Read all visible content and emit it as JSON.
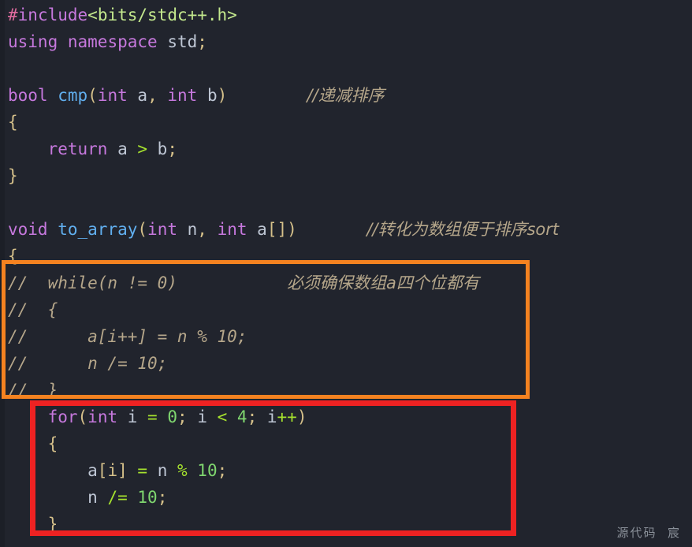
{
  "editor": {
    "background_color": "#21242d",
    "default_text_color": "#c3c9c9",
    "font_size_px": 21,
    "line_height_px": 34
  },
  "watermark": {
    "text": "源代码  宸",
    "color": "#8a9099"
  },
  "highlights": [
    {
      "name": "orange-box",
      "color": "#f58220",
      "encloses_lines": [
        10,
        11,
        12,
        13,
        14
      ],
      "note": "commented-out while loop block"
    },
    {
      "name": "red-box",
      "color": "#ee2222",
      "encloses_lines": [
        15,
        16,
        17,
        18,
        19
      ],
      "note": "active for loop block"
    }
  ],
  "code_lines": [
    {
      "n": 1,
      "tokens": [
        {
          "t": "#",
          "c": "pp"
        },
        {
          "t": "include",
          "c": "ppkw"
        },
        {
          "t": "<bits/stdc++.h>",
          "c": "str"
        }
      ]
    },
    {
      "n": 2,
      "tokens": [
        {
          "t": "using",
          "c": "kw"
        },
        {
          "t": " ",
          "c": "var"
        },
        {
          "t": "namespace",
          "c": "kw"
        },
        {
          "t": " ",
          "c": "var"
        },
        {
          "t": "std",
          "c": "var"
        },
        {
          "t": ";",
          "c": "semi"
        }
      ]
    },
    {
      "n": 3,
      "tokens": []
    },
    {
      "n": 4,
      "tokens": [
        {
          "t": "bool",
          "c": "kw"
        },
        {
          "t": " ",
          "c": "var"
        },
        {
          "t": "cmp",
          "c": "fn"
        },
        {
          "t": "(",
          "c": "punc"
        },
        {
          "t": "int",
          "c": "kw"
        },
        {
          "t": " a",
          "c": "var"
        },
        {
          "t": ",",
          "c": "punc"
        },
        {
          "t": " ",
          "c": "var"
        },
        {
          "t": "int",
          "c": "kw"
        },
        {
          "t": " b",
          "c": "var"
        },
        {
          "t": ")",
          "c": "punc"
        },
        {
          "t": "        ",
          "c": "var"
        },
        {
          "t": "//递减排序",
          "c": "cmt-cn"
        }
      ]
    },
    {
      "n": 5,
      "tokens": [
        {
          "t": "{",
          "c": "punc"
        }
      ]
    },
    {
      "n": 6,
      "tokens": [
        {
          "t": "    ",
          "c": "var"
        },
        {
          "t": "return",
          "c": "kw"
        },
        {
          "t": " a ",
          "c": "var"
        },
        {
          "t": ">",
          "c": "opg"
        },
        {
          "t": " b",
          "c": "var"
        },
        {
          "t": ";",
          "c": "semi"
        }
      ]
    },
    {
      "n": 7,
      "tokens": [
        {
          "t": "}",
          "c": "punc"
        }
      ]
    },
    {
      "n": 8,
      "tokens": []
    },
    {
      "n": 9,
      "tokens": [
        {
          "t": "void",
          "c": "kw"
        },
        {
          "t": " ",
          "c": "var"
        },
        {
          "t": "to_array",
          "c": "fn"
        },
        {
          "t": "(",
          "c": "punc"
        },
        {
          "t": "int",
          "c": "kw"
        },
        {
          "t": " n",
          "c": "var"
        },
        {
          "t": ",",
          "c": "punc"
        },
        {
          "t": " ",
          "c": "var"
        },
        {
          "t": "int",
          "c": "kw"
        },
        {
          "t": " a",
          "c": "var"
        },
        {
          "t": "[]",
          "c": "punc"
        },
        {
          "t": ")",
          "c": "punc"
        },
        {
          "t": "       ",
          "c": "var"
        },
        {
          "t": "//转化为数组便于排序sort",
          "c": "cmt-cn"
        }
      ]
    },
    {
      "n": 10,
      "tokens": [
        {
          "t": "{",
          "c": "punc"
        }
      ]
    },
    {
      "n": 11,
      "comment": true,
      "tokens": [
        {
          "t": "//  while(n != 0)           ",
          "c": "cmt"
        },
        {
          "t": "必须确保数组a四个位都有",
          "c": "cmt-cn"
        }
      ]
    },
    {
      "n": 12,
      "comment": true,
      "tokens": [
        {
          "t": "//  {",
          "c": "cmt"
        }
      ]
    },
    {
      "n": 13,
      "comment": true,
      "tokens": [
        {
          "t": "//      a[i++] = n % 10;",
          "c": "cmt"
        }
      ]
    },
    {
      "n": 14,
      "comment": true,
      "tokens": [
        {
          "t": "//      n /= 10;",
          "c": "cmt"
        }
      ]
    },
    {
      "n": 15,
      "comment": true,
      "tokens": [
        {
          "t": "//  }",
          "c": "cmt"
        }
      ]
    },
    {
      "n": 16,
      "tokens": [
        {
          "t": "    ",
          "c": "var"
        },
        {
          "t": "for",
          "c": "kw"
        },
        {
          "t": "(",
          "c": "punc"
        },
        {
          "t": "int",
          "c": "kw"
        },
        {
          "t": " i ",
          "c": "var"
        },
        {
          "t": "=",
          "c": "opg"
        },
        {
          "t": " ",
          "c": "var"
        },
        {
          "t": "0",
          "c": "num"
        },
        {
          "t": ";",
          "c": "semi"
        },
        {
          "t": " i ",
          "c": "var"
        },
        {
          "t": "<",
          "c": "opg"
        },
        {
          "t": " ",
          "c": "var"
        },
        {
          "t": "4",
          "c": "num"
        },
        {
          "t": ";",
          "c": "semi"
        },
        {
          "t": " i",
          "c": "var"
        },
        {
          "t": "++",
          "c": "opg"
        },
        {
          "t": ")",
          "c": "punc"
        }
      ]
    },
    {
      "n": 17,
      "tokens": [
        {
          "t": "    ",
          "c": "var"
        },
        {
          "t": "{",
          "c": "punc"
        }
      ]
    },
    {
      "n": 18,
      "tokens": [
        {
          "t": "        a",
          "c": "var"
        },
        {
          "t": "[i]",
          "c": "punc"
        },
        {
          "t": " ",
          "c": "var"
        },
        {
          "t": "=",
          "c": "opg"
        },
        {
          "t": " n ",
          "c": "var"
        },
        {
          "t": "%",
          "c": "opg"
        },
        {
          "t": " ",
          "c": "var"
        },
        {
          "t": "10",
          "c": "num"
        },
        {
          "t": ";",
          "c": "semi"
        }
      ]
    },
    {
      "n": 19,
      "tokens": [
        {
          "t": "        n ",
          "c": "var"
        },
        {
          "t": "/",
          "c": "opg"
        },
        {
          "t": "= ",
          "c": "opg"
        },
        {
          "t": "10",
          "c": "num"
        },
        {
          "t": ";",
          "c": "semi"
        }
      ]
    },
    {
      "n": 20,
      "tokens": [
        {
          "t": "    ",
          "c": "var"
        },
        {
          "t": "}",
          "c": "punc"
        }
      ]
    }
  ]
}
